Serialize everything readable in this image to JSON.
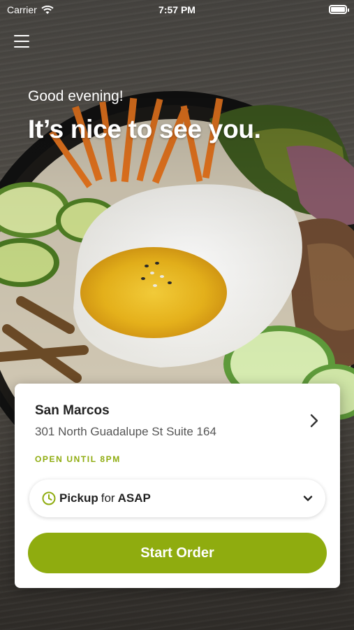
{
  "status_bar": {
    "carrier": "Carrier",
    "time": "7:57 PM"
  },
  "header": {
    "greeting": "Good evening!",
    "headline": "It’s nice to see you."
  },
  "location_card": {
    "store_name": "San Marcos",
    "address": "301 North Guadalupe St Suite 164",
    "hours": "OPEN UNTIL 8PM",
    "order_mode": {
      "method": "Pickup",
      "connector": "for",
      "time": "ASAP"
    },
    "start_button": "Start Order"
  },
  "colors": {
    "accent": "#8fac0f",
    "card_bg": "#ffffff",
    "text_dark": "#222222"
  },
  "icons": {
    "menu": "hamburger-icon",
    "wifi": "wifi-icon",
    "battery": "battery-icon",
    "chevron": "chevron-right-icon",
    "clock": "clock-icon",
    "dropdown": "chevron-down-icon"
  }
}
